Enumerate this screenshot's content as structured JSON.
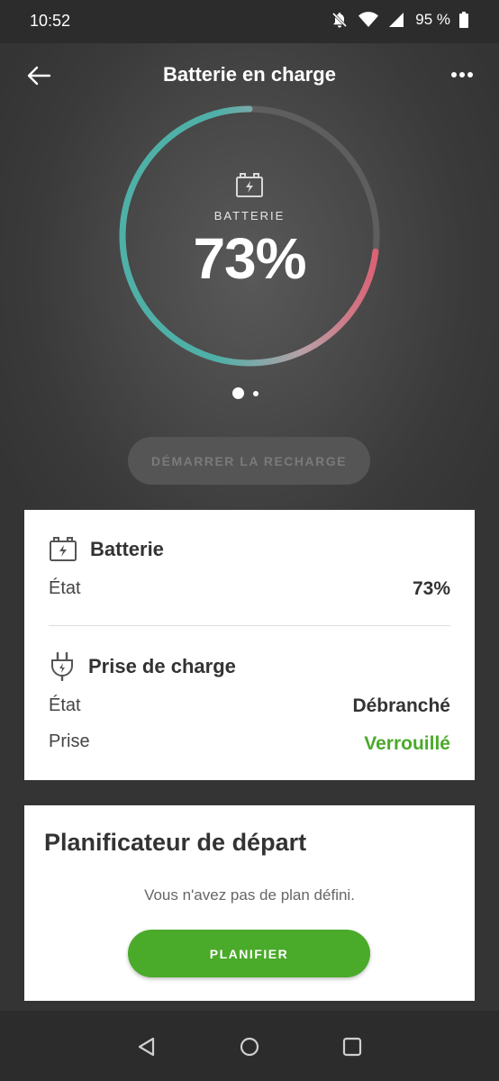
{
  "status_bar": {
    "time": "10:52",
    "battery_percent": "95 %",
    "icons": [
      "notifications-off-icon",
      "wifi-icon",
      "cell-signal-icon",
      "battery-icon"
    ]
  },
  "header": {
    "title": "Batterie en charge",
    "back_icon": "arrow-left-icon",
    "more_icon": "more-horizontal-icon"
  },
  "gauge": {
    "label": "BATTERIE",
    "value_text": "73%",
    "level": 0.73,
    "icon": "battery-charging-icon",
    "colors": {
      "start": "#e05a6e",
      "end": "#4fb0a8",
      "track": "#5e5e5e"
    }
  },
  "pager": {
    "pages": 2,
    "active": 0
  },
  "start_charge_button": {
    "label": "DÉMARRER LA RECHARGE",
    "enabled": false
  },
  "battery_section": {
    "title": "Batterie",
    "icon": "battery-charging-icon",
    "rows": [
      {
        "label": "État",
        "value": "73%"
      }
    ]
  },
  "plug_section": {
    "title": "Prise de charge",
    "icon": "plug-icon",
    "rows": [
      {
        "label": "État",
        "value": "Débranché"
      },
      {
        "label": "Prise",
        "value": "Verrouillé",
        "color": "#4aaa2a"
      }
    ]
  },
  "planner": {
    "title": "Planificateur de départ",
    "message": "Vous n'avez pas de plan défini.",
    "button_label": "PLANIFIER",
    "accent": "#4aaa2a"
  },
  "nav_bar": {
    "icons": [
      "nav-back-icon",
      "nav-home-icon",
      "nav-recents-icon"
    ]
  }
}
